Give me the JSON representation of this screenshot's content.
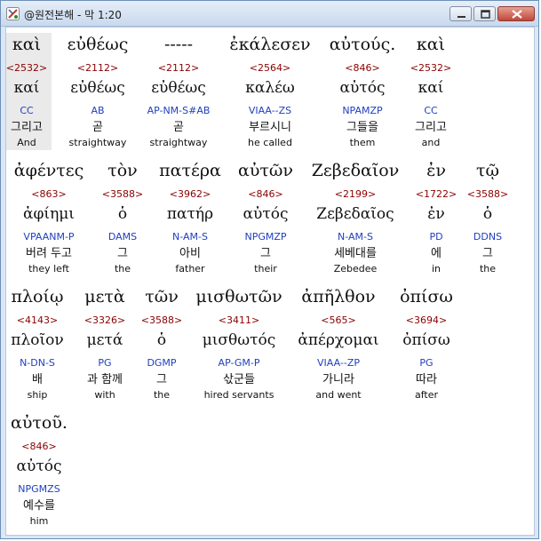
{
  "window": {
    "title": "@원전본해 - 막 1:20"
  },
  "words": [
    {
      "greek": "καὶ",
      "strong": "<2532>",
      "lemma": "καί",
      "parse": "CC",
      "korean": "그리고",
      "english": "And",
      "highlighted": true
    },
    {
      "greek": "εὐθέως",
      "strong": "<2112>",
      "lemma": "εὐθέως",
      "parse": "AB",
      "korean": "곧",
      "english": "straightway",
      "highlighted": false
    },
    {
      "greek": "-----",
      "strong": "<2112>",
      "lemma": "εὐθέως",
      "parse": "AP-NM-S#AB",
      "korean": "곧",
      "english": "straightway",
      "highlighted": false
    },
    {
      "greek": "ἐκάλεσεν",
      "strong": "<2564>",
      "lemma": "καλέω",
      "parse": "VIAA--ZS",
      "korean": "부르시니",
      "english": "he called",
      "highlighted": false
    },
    {
      "greek": "αὐτούς.",
      "strong": "<846>",
      "lemma": "αὐτός",
      "parse": "NPAMZP",
      "korean": "그들을",
      "english": "them",
      "highlighted": false
    },
    {
      "greek": "καὶ",
      "strong": "<2532>",
      "lemma": "καί",
      "parse": "CC",
      "korean": "그리고",
      "english": "and",
      "highlighted": false
    },
    {
      "greek": "ἀφέντες",
      "strong": "<863>",
      "lemma": "ἀφίημι",
      "parse": "VPAANM-P",
      "korean": "버려 두고",
      "english": "they left",
      "highlighted": false
    },
    {
      "greek": "τὸν",
      "strong": "<3588>",
      "lemma": "ὁ",
      "parse": "DAMS",
      "korean": "그",
      "english": "the",
      "highlighted": false
    },
    {
      "greek": "πατέρα",
      "strong": "<3962>",
      "lemma": "πατήρ",
      "parse": "N-AM-S",
      "korean": "아비",
      "english": "father",
      "highlighted": false
    },
    {
      "greek": "αὐτῶν",
      "strong": "<846>",
      "lemma": "αὐτός",
      "parse": "NPGMZP",
      "korean": "그",
      "english": "their",
      "highlighted": false
    },
    {
      "greek": "Ζεβεδαῖον",
      "strong": "<2199>",
      "lemma": "Ζεβεδαῖος",
      "parse": "N-AM-S",
      "korean": "세베대를",
      "english": "Zebedee",
      "highlighted": false
    },
    {
      "greek": "ἐν",
      "strong": "<1722>",
      "lemma": "ἐν",
      "parse": "PD",
      "korean": "에",
      "english": "in",
      "highlighted": false
    },
    {
      "greek": "τῷ",
      "strong": "<3588>",
      "lemma": "ὁ",
      "parse": "DDNS",
      "korean": "그",
      "english": "the",
      "highlighted": false
    },
    {
      "greek": "πλοίῳ",
      "strong": "<4143>",
      "lemma": "πλοῖον",
      "parse": "N-DN-S",
      "korean": "배",
      "english": "ship",
      "highlighted": false
    },
    {
      "greek": "μετὰ",
      "strong": "<3326>",
      "lemma": "μετά",
      "parse": "PG",
      "korean": "과 함께",
      "english": "with",
      "highlighted": false
    },
    {
      "greek": "τῶν",
      "strong": "<3588>",
      "lemma": "ὁ",
      "parse": "DGMP",
      "korean": "그",
      "english": "the",
      "highlighted": false
    },
    {
      "greek": "μισθωτῶν",
      "strong": "<3411>",
      "lemma": "μισθωτός",
      "parse": "AP-GM-P",
      "korean": "삯군들",
      "english": "hired servants",
      "highlighted": false
    },
    {
      "greek": "ἀπῆλθον",
      "strong": "<565>",
      "lemma": "ἀπέρχομαι",
      "parse": "VIAA--ZP",
      "korean": "가니라",
      "english": "and went",
      "highlighted": false
    },
    {
      "greek": "ὀπίσω",
      "strong": "<3694>",
      "lemma": "ὀπίσω",
      "parse": "PG",
      "korean": "따라",
      "english": "after",
      "highlighted": false
    },
    {
      "greek": "αὐτοῦ.",
      "strong": "<846>",
      "lemma": "αὐτός",
      "parse": "NPGMZS",
      "korean": "예수를",
      "english": "him",
      "highlighted": false
    }
  ]
}
